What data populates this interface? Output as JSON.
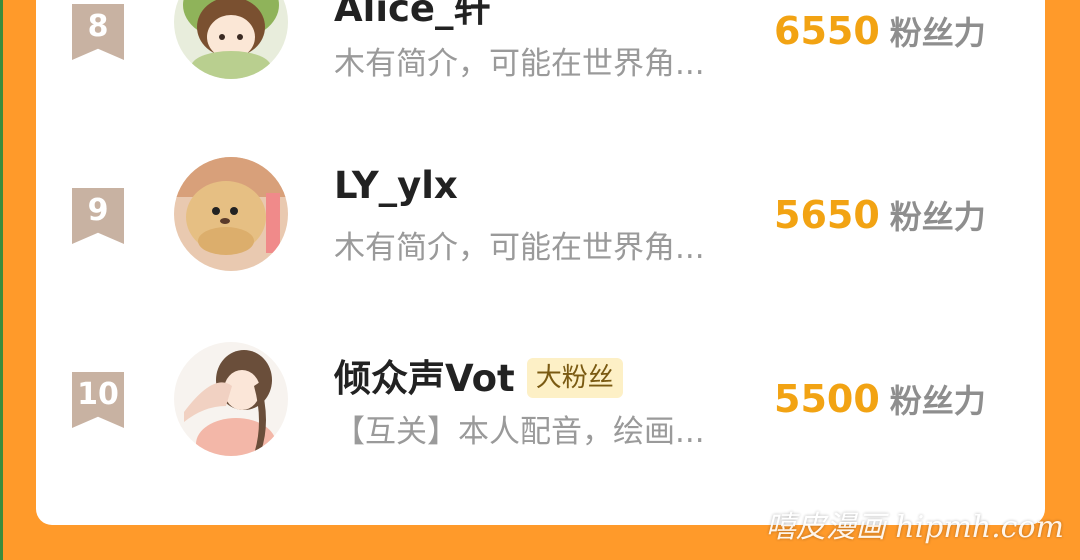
{
  "rows": [
    {
      "rank": "8",
      "name": "Alice_轩",
      "bio": "木有简介，可能在世界角...",
      "score": "6550",
      "unit": "粉丝力",
      "badge": "",
      "avatar_icon": "anime-girl-avatar-icon"
    },
    {
      "rank": "9",
      "name": "LY_ylx",
      "bio": "木有简介，可能在世界角...",
      "score": "5650",
      "unit": "粉丝力",
      "badge": "",
      "avatar_icon": "plush-toy-avatar-icon"
    },
    {
      "rank": "10",
      "name": "倾众声Vot",
      "bio": "【互关】本人配音，绘画...",
      "score": "5500",
      "unit": "粉丝力",
      "badge": "大粉丝",
      "avatar_icon": "illustrated-girl-avatar-icon"
    }
  ],
  "watermark": "嘻皮漫画 hipmh.com",
  "colors": {
    "background": "#ff9a2a",
    "score": "#f2a313",
    "rank_badge": "#c8b2a2"
  }
}
